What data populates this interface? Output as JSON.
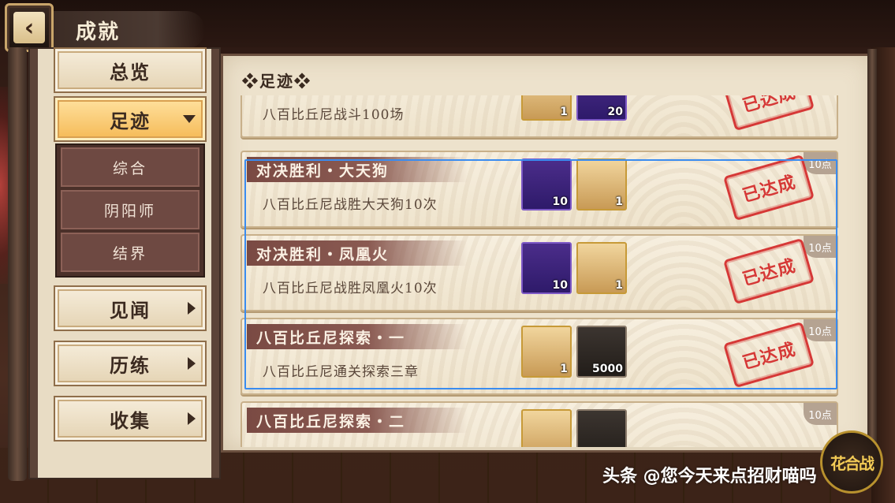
{
  "header": {
    "back_icon": "chevron-left-icon",
    "title": "成就"
  },
  "sidebar": {
    "items": [
      {
        "label": "总览",
        "expanded": false,
        "has_arrow": false
      },
      {
        "label": "足迹",
        "expanded": true,
        "has_arrow": true,
        "active": true
      },
      {
        "label": "见闻",
        "expanded": false,
        "has_arrow": true
      },
      {
        "label": "历练",
        "expanded": false,
        "has_arrow": true
      },
      {
        "label": "收集",
        "expanded": false,
        "has_arrow": true
      }
    ],
    "subitems": [
      {
        "label": "综合"
      },
      {
        "label": "阴阳师"
      },
      {
        "label": "结界"
      }
    ]
  },
  "main": {
    "section_title": "❖足迹❖",
    "achievements": [
      {
        "title": "",
        "desc": "八百比丘尼战斗100场",
        "points": "",
        "status": "已达成",
        "rewards": [
          {
            "type": "character",
            "count": "1"
          },
          {
            "type": "orb",
            "count": "20"
          }
        ]
      },
      {
        "title": "对决胜利・大天狗",
        "desc": "八百比丘尼战胜大天狗10次",
        "points": "10点",
        "status": "已达成",
        "rewards": [
          {
            "type": "orb",
            "count": "10"
          },
          {
            "type": "character",
            "count": "1"
          }
        ]
      },
      {
        "title": "对决胜利・凤凰火",
        "desc": "八百比丘尼战胜凤凰火10次",
        "points": "10点",
        "status": "已达成",
        "rewards": [
          {
            "type": "orb",
            "count": "10"
          },
          {
            "type": "character",
            "count": "1"
          }
        ]
      },
      {
        "title": "八百比丘尼探索・一",
        "desc": "八百比丘尼通关探索三章",
        "points": "10点",
        "status": "已达成",
        "rewards": [
          {
            "type": "character",
            "count": "1"
          },
          {
            "type": "coin",
            "count": "5000"
          }
        ]
      },
      {
        "title": "八百比丘尼探索・二",
        "desc": "",
        "points": "10点",
        "status": "",
        "rewards": [
          {
            "type": "character",
            "count": ""
          },
          {
            "type": "coin",
            "count": ""
          }
        ]
      }
    ]
  },
  "emblem": {
    "text": "花合战"
  },
  "watermark": {
    "text": "头条 @您今天来点招财喵吗"
  },
  "colors": {
    "selection_outline": "#3a8cf0",
    "stamp_red": "#d42a2a",
    "active_tab": "#f5b955"
  }
}
